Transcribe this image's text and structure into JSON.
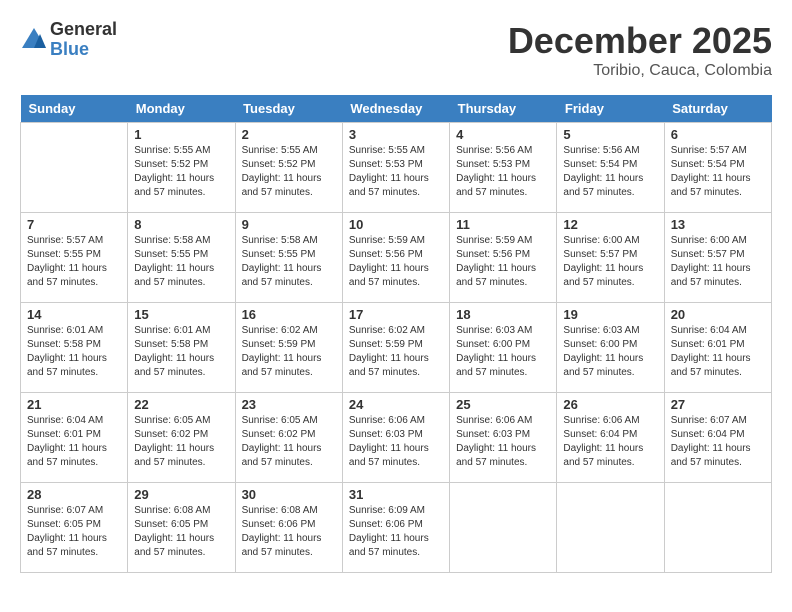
{
  "logo": {
    "general": "General",
    "blue": "Blue"
  },
  "title": {
    "month_year": "December 2025",
    "location": "Toribio, Cauca, Colombia"
  },
  "headers": [
    "Sunday",
    "Monday",
    "Tuesday",
    "Wednesday",
    "Thursday",
    "Friday",
    "Saturday"
  ],
  "weeks": [
    [
      {
        "day": "",
        "sunrise": "",
        "sunset": "",
        "daylight": ""
      },
      {
        "day": "1",
        "sunrise": "Sunrise: 5:55 AM",
        "sunset": "Sunset: 5:52 PM",
        "daylight": "Daylight: 11 hours and 57 minutes."
      },
      {
        "day": "2",
        "sunrise": "Sunrise: 5:55 AM",
        "sunset": "Sunset: 5:52 PM",
        "daylight": "Daylight: 11 hours and 57 minutes."
      },
      {
        "day": "3",
        "sunrise": "Sunrise: 5:55 AM",
        "sunset": "Sunset: 5:53 PM",
        "daylight": "Daylight: 11 hours and 57 minutes."
      },
      {
        "day": "4",
        "sunrise": "Sunrise: 5:56 AM",
        "sunset": "Sunset: 5:53 PM",
        "daylight": "Daylight: 11 hours and 57 minutes."
      },
      {
        "day": "5",
        "sunrise": "Sunrise: 5:56 AM",
        "sunset": "Sunset: 5:54 PM",
        "daylight": "Daylight: 11 hours and 57 minutes."
      },
      {
        "day": "6",
        "sunrise": "Sunrise: 5:57 AM",
        "sunset": "Sunset: 5:54 PM",
        "daylight": "Daylight: 11 hours and 57 minutes."
      }
    ],
    [
      {
        "day": "7",
        "sunrise": "Sunrise: 5:57 AM",
        "sunset": "Sunset: 5:55 PM",
        "daylight": "Daylight: 11 hours and 57 minutes."
      },
      {
        "day": "8",
        "sunrise": "Sunrise: 5:58 AM",
        "sunset": "Sunset: 5:55 PM",
        "daylight": "Daylight: 11 hours and 57 minutes."
      },
      {
        "day": "9",
        "sunrise": "Sunrise: 5:58 AM",
        "sunset": "Sunset: 5:55 PM",
        "daylight": "Daylight: 11 hours and 57 minutes."
      },
      {
        "day": "10",
        "sunrise": "Sunrise: 5:59 AM",
        "sunset": "Sunset: 5:56 PM",
        "daylight": "Daylight: 11 hours and 57 minutes."
      },
      {
        "day": "11",
        "sunrise": "Sunrise: 5:59 AM",
        "sunset": "Sunset: 5:56 PM",
        "daylight": "Daylight: 11 hours and 57 minutes."
      },
      {
        "day": "12",
        "sunrise": "Sunrise: 6:00 AM",
        "sunset": "Sunset: 5:57 PM",
        "daylight": "Daylight: 11 hours and 57 minutes."
      },
      {
        "day": "13",
        "sunrise": "Sunrise: 6:00 AM",
        "sunset": "Sunset: 5:57 PM",
        "daylight": "Daylight: 11 hours and 57 minutes."
      }
    ],
    [
      {
        "day": "14",
        "sunrise": "Sunrise: 6:01 AM",
        "sunset": "Sunset: 5:58 PM",
        "daylight": "Daylight: 11 hours and 57 minutes."
      },
      {
        "day": "15",
        "sunrise": "Sunrise: 6:01 AM",
        "sunset": "Sunset: 5:58 PM",
        "daylight": "Daylight: 11 hours and 57 minutes."
      },
      {
        "day": "16",
        "sunrise": "Sunrise: 6:02 AM",
        "sunset": "Sunset: 5:59 PM",
        "daylight": "Daylight: 11 hours and 57 minutes."
      },
      {
        "day": "17",
        "sunrise": "Sunrise: 6:02 AM",
        "sunset": "Sunset: 5:59 PM",
        "daylight": "Daylight: 11 hours and 57 minutes."
      },
      {
        "day": "18",
        "sunrise": "Sunrise: 6:03 AM",
        "sunset": "Sunset: 6:00 PM",
        "daylight": "Daylight: 11 hours and 57 minutes."
      },
      {
        "day": "19",
        "sunrise": "Sunrise: 6:03 AM",
        "sunset": "Sunset: 6:00 PM",
        "daylight": "Daylight: 11 hours and 57 minutes."
      },
      {
        "day": "20",
        "sunrise": "Sunrise: 6:04 AM",
        "sunset": "Sunset: 6:01 PM",
        "daylight": "Daylight: 11 hours and 57 minutes."
      }
    ],
    [
      {
        "day": "21",
        "sunrise": "Sunrise: 6:04 AM",
        "sunset": "Sunset: 6:01 PM",
        "daylight": "Daylight: 11 hours and 57 minutes."
      },
      {
        "day": "22",
        "sunrise": "Sunrise: 6:05 AM",
        "sunset": "Sunset: 6:02 PM",
        "daylight": "Daylight: 11 hours and 57 minutes."
      },
      {
        "day": "23",
        "sunrise": "Sunrise: 6:05 AM",
        "sunset": "Sunset: 6:02 PM",
        "daylight": "Daylight: 11 hours and 57 minutes."
      },
      {
        "day": "24",
        "sunrise": "Sunrise: 6:06 AM",
        "sunset": "Sunset: 6:03 PM",
        "daylight": "Daylight: 11 hours and 57 minutes."
      },
      {
        "day": "25",
        "sunrise": "Sunrise: 6:06 AM",
        "sunset": "Sunset: 6:03 PM",
        "daylight": "Daylight: 11 hours and 57 minutes."
      },
      {
        "day": "26",
        "sunrise": "Sunrise: 6:06 AM",
        "sunset": "Sunset: 6:04 PM",
        "daylight": "Daylight: 11 hours and 57 minutes."
      },
      {
        "day": "27",
        "sunrise": "Sunrise: 6:07 AM",
        "sunset": "Sunset: 6:04 PM",
        "daylight": "Daylight: 11 hours and 57 minutes."
      }
    ],
    [
      {
        "day": "28",
        "sunrise": "Sunrise: 6:07 AM",
        "sunset": "Sunset: 6:05 PM",
        "daylight": "Daylight: 11 hours and 57 minutes."
      },
      {
        "day": "29",
        "sunrise": "Sunrise: 6:08 AM",
        "sunset": "Sunset: 6:05 PM",
        "daylight": "Daylight: 11 hours and 57 minutes."
      },
      {
        "day": "30",
        "sunrise": "Sunrise: 6:08 AM",
        "sunset": "Sunset: 6:06 PM",
        "daylight": "Daylight: 11 hours and 57 minutes."
      },
      {
        "day": "31",
        "sunrise": "Sunrise: 6:09 AM",
        "sunset": "Sunset: 6:06 PM",
        "daylight": "Daylight: 11 hours and 57 minutes."
      },
      {
        "day": "",
        "sunrise": "",
        "sunset": "",
        "daylight": ""
      },
      {
        "day": "",
        "sunrise": "",
        "sunset": "",
        "daylight": ""
      },
      {
        "day": "",
        "sunrise": "",
        "sunset": "",
        "daylight": ""
      }
    ]
  ]
}
